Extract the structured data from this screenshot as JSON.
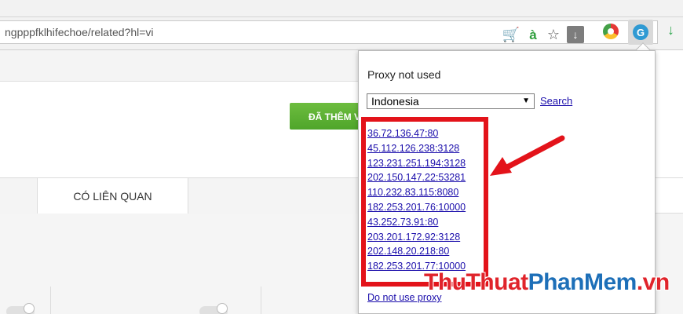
{
  "browser": {
    "url": "ngpppfklhifechoe/related?hl=vi",
    "icons": [
      "cart-icon",
      "a-icon",
      "star-icon",
      "download-icon",
      "chromium-ext-icon",
      "proxy-ext-icon",
      "green-download-icon"
    ]
  },
  "page": {
    "add_button_label": "ĐÃ THÊM VÀO",
    "tabs": [
      {
        "label": "CÓ LIÊN QUAN"
      }
    ]
  },
  "popup": {
    "status": "Proxy not used",
    "country": "Indonesia",
    "search_label": "Search",
    "proxies": [
      "36.72.136.47:80",
      "45.112.126.238:3128",
      "123.231.251.194:3128",
      "202.150.147.22:53281",
      "110.232.83.115:8080",
      "182.253.201.76:10000",
      "43.252.73.91:80",
      "203.201.172.92:3128",
      "202.148.20.218:80",
      "182.253.201.77:10000"
    ],
    "disable_label": "Do not use proxy"
  },
  "watermark": {
    "part1": "Thu",
    "part2": "Thuat",
    "part3": "PhanMem",
    "part4": ".vn"
  },
  "colors": {
    "highlight": "#e3131a",
    "link": "#1a0dab",
    "button": "#5aaf33"
  }
}
